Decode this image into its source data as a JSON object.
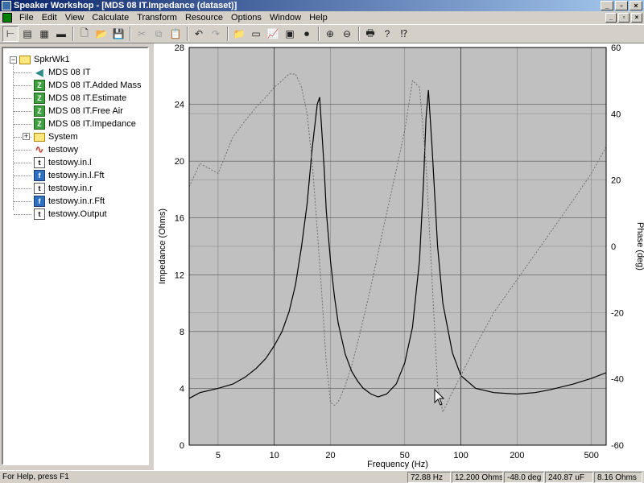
{
  "window": {
    "title": "Speaker Workshop - [MDS 08 IT.Impedance (dataset)]"
  },
  "menu": [
    "File",
    "Edit",
    "View",
    "Calculate",
    "Transform",
    "Resource",
    "Options",
    "Window",
    "Help"
  ],
  "tree": {
    "root": "SpkrWk1",
    "items": [
      {
        "label": "MDS 08 IT",
        "icon": "speaker-icon"
      },
      {
        "label": "MDS 08 IT.Added Mass",
        "icon": "impedance-z-icon"
      },
      {
        "label": "MDS 08 IT.Estimate",
        "icon": "impedance-z-icon"
      },
      {
        "label": "MDS 08 IT.Free Air",
        "icon": "impedance-z-icon"
      },
      {
        "label": "MDS 08 IT.Impedance",
        "icon": "impedance-z-icon"
      },
      {
        "label": "System",
        "icon": "folder-icon"
      },
      {
        "label": "testowy",
        "icon": "signal-wave-icon"
      },
      {
        "label": "testowy.in.l",
        "icon": "time-data-icon"
      },
      {
        "label": "testowy.in.l.Fft",
        "icon": "freq-data-icon"
      },
      {
        "label": "testowy.in.r",
        "icon": "time-data-icon"
      },
      {
        "label": "testowy.in.r.Fft",
        "icon": "freq-data-icon"
      },
      {
        "label": "testowy.Output",
        "icon": "time-data-icon"
      }
    ]
  },
  "status": {
    "help": "For Help, press F1",
    "frequency": "72.88 Hz",
    "impedance": "12.200 Ohms",
    "phase": "-48.0 deg",
    "capacitance": "240.87 uF",
    "ohms": "8.16 Ohms"
  },
  "colors": {
    "plot_bg": "#c0c0c0",
    "impedance_line": "#000000",
    "phase_line": "#6e6e6e"
  },
  "chart_data": {
    "type": "line",
    "xlabel": "Frequency (Hz)",
    "ylabel": "Impedance (Ohms)",
    "y2label": "Phase (deg)",
    "xscale": "log",
    "xlim": [
      3.5,
      600
    ],
    "ylim": [
      0,
      28
    ],
    "y2lim": [
      -60,
      60
    ],
    "xticks": [
      5,
      10,
      20,
      50,
      100,
      200,
      500
    ],
    "yticks": [
      0,
      4,
      8,
      12,
      16,
      20,
      24,
      28
    ],
    "y2ticks": [
      -60,
      -40,
      -20,
      0,
      20,
      40,
      60
    ],
    "grid": true,
    "series": [
      {
        "axis": "left",
        "style": "solid",
        "x": [
          3.5,
          4,
          5,
          6,
          7,
          8,
          9,
          10,
          11,
          12,
          13,
          14,
          15,
          16,
          17,
          17.5,
          18,
          18.5,
          19,
          20,
          21,
          22,
          24,
          26,
          28,
          30,
          33,
          36,
          40,
          45,
          50,
          55,
          60,
          63,
          65,
          67,
          70,
          75,
          80,
          90,
          100,
          120,
          150,
          200,
          250,
          300,
          400,
          500,
          600
        ],
        "y": [
          3.3,
          3.7,
          4.0,
          4.3,
          4.8,
          5.4,
          6.1,
          7.0,
          8.0,
          9.4,
          11.3,
          14.0,
          17.0,
          21.0,
          24.0,
          24.5,
          22.0,
          19.5,
          16.5,
          13.0,
          10.5,
          8.6,
          6.4,
          5.2,
          4.5,
          4.0,
          3.6,
          3.4,
          3.6,
          4.3,
          5.8,
          8.3,
          13.0,
          18.5,
          23.0,
          25.0,
          21.0,
          14.0,
          10.0,
          6.5,
          4.9,
          4.0,
          3.7,
          3.6,
          3.7,
          3.9,
          4.3,
          4.7,
          5.1
        ]
      },
      {
        "axis": "right",
        "style": "dotted",
        "x": [
          3.5,
          4,
          5,
          6,
          7,
          8,
          9,
          10,
          11,
          12,
          13,
          14,
          15,
          16,
          17,
          18,
          19,
          20,
          21,
          22,
          24,
          26,
          28,
          30,
          33,
          36,
          40,
          45,
          50,
          55,
          60,
          65,
          70,
          75,
          80,
          90,
          100,
          120,
          150,
          200,
          300,
          400,
          500,
          600
        ],
        "y": [
          18,
          25,
          22,
          33,
          38,
          42,
          45,
          48,
          50,
          52,
          52,
          48,
          40,
          25,
          5,
          -15,
          -35,
          -47,
          -48,
          -47,
          -42,
          -36,
          -29,
          -22,
          -12,
          -2,
          10,
          23,
          35,
          50,
          48,
          25,
          -10,
          -42,
          -50,
          -44,
          -39,
          -30,
          -20,
          -10,
          4,
          14,
          22,
          30
        ]
      }
    ]
  }
}
